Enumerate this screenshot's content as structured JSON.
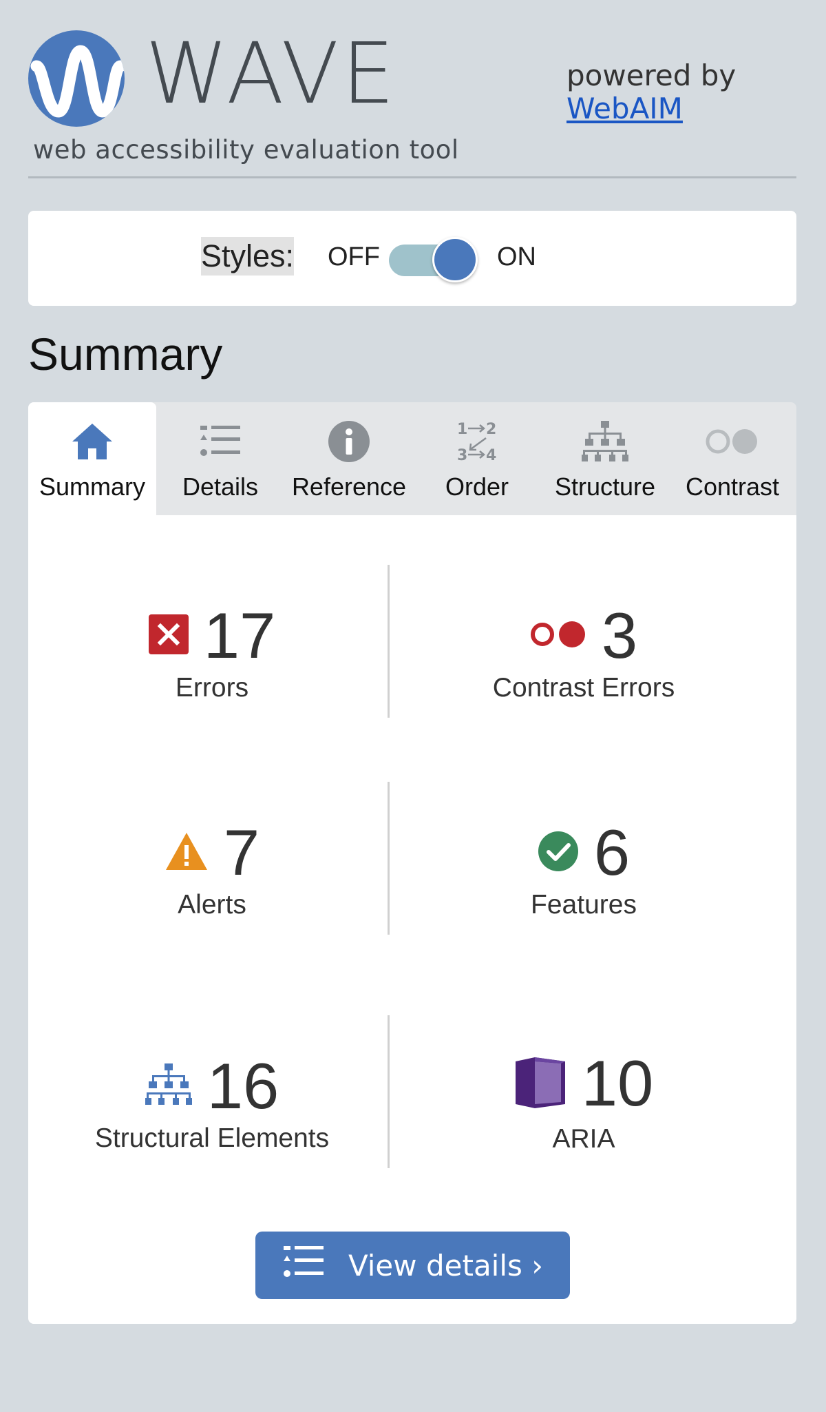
{
  "header": {
    "app_title": "WAVE",
    "tagline": "web accessibility evaluation tool",
    "powered_by": "powered by",
    "powered_link": "WebAIM",
    "logo_icon": "wave-logo-icon"
  },
  "styles": {
    "label": "Styles:",
    "off_label": "OFF",
    "on_label": "ON",
    "state": "on"
  },
  "summary_heading": "Summary",
  "tabs": [
    {
      "label": "Summary",
      "icon": "home-icon",
      "active": true
    },
    {
      "label": "Details",
      "icon": "list-icon",
      "active": false
    },
    {
      "label": "Reference",
      "icon": "info-icon",
      "active": false
    },
    {
      "label": "Order",
      "icon": "order-icon",
      "active": false
    },
    {
      "label": "Structure",
      "icon": "structure-icon",
      "active": false
    },
    {
      "label": "Contrast",
      "icon": "contrast-icon",
      "active": false
    }
  ],
  "stats": {
    "errors": {
      "count": "17",
      "label": "Errors",
      "icon": "error-icon",
      "color": "#c1272d"
    },
    "contrast_errors": {
      "count": "3",
      "label": "Contrast Errors",
      "icon": "contrast-error-icon",
      "color": "#c1272d"
    },
    "alerts": {
      "count": "7",
      "label": "Alerts",
      "icon": "alert-icon",
      "color": "#e8901f"
    },
    "features": {
      "count": "6",
      "label": "Features",
      "icon": "feature-check-icon",
      "color": "#3a8a5c"
    },
    "structural": {
      "count": "16",
      "label": "Structural Elements",
      "icon": "structure-icon",
      "color": "#4a78bb"
    },
    "aria": {
      "count": "10",
      "label": "ARIA",
      "icon": "aria-icon",
      "color": "#5b2d8a"
    }
  },
  "view_details": {
    "label": "View details ›",
    "icon": "list-icon"
  },
  "colors": {
    "accent": "#4a78bb",
    "background": "#d5dbe0",
    "link": "#1a56c4"
  }
}
